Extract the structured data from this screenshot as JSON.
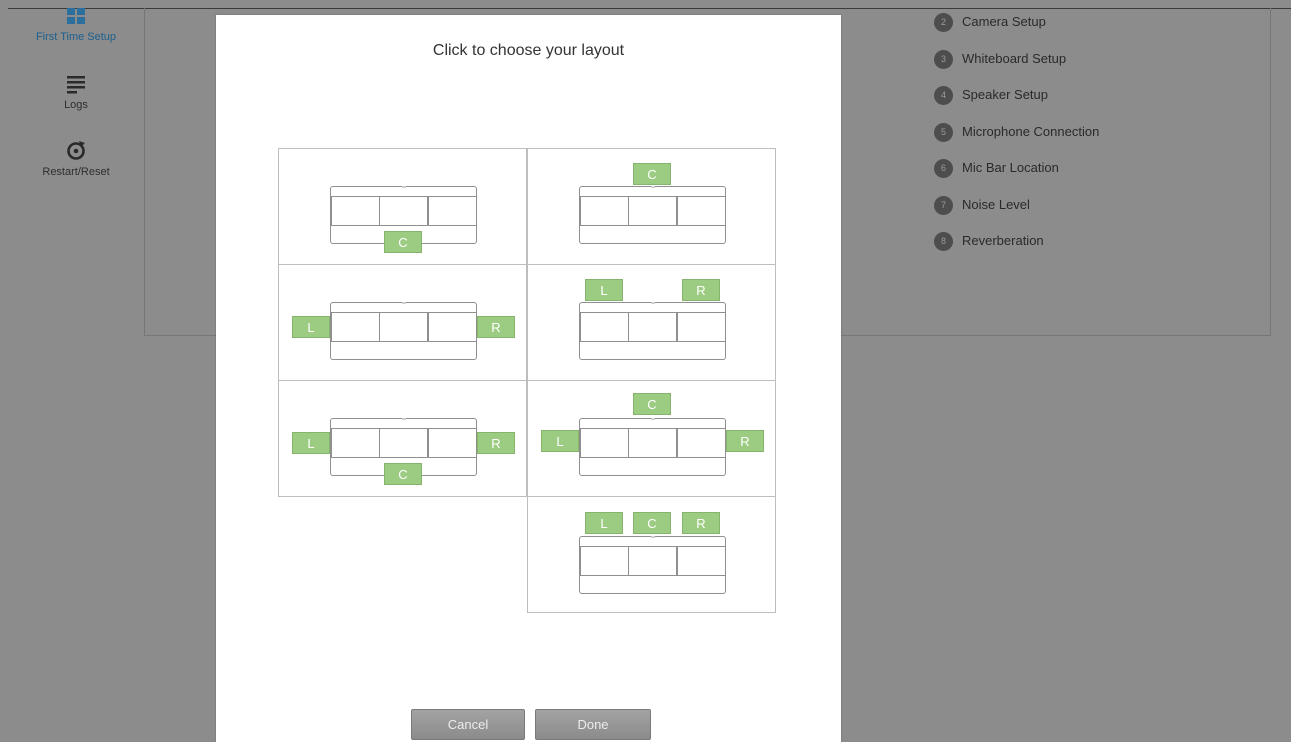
{
  "sidebar": {
    "items": [
      {
        "label": "First Time Setup",
        "icon": "grid-icon",
        "active": true
      },
      {
        "label": "Logs",
        "icon": "lines-icon"
      },
      {
        "label": "Restart/Reset",
        "icon": "restart-icon"
      }
    ]
  },
  "steps": [
    {
      "num": "2",
      "label": "Camera Setup"
    },
    {
      "num": "3",
      "label": "Whiteboard Setup"
    },
    {
      "num": "4",
      "label": "Speaker Setup"
    },
    {
      "num": "5",
      "label": "Microphone Connection"
    },
    {
      "num": "6",
      "label": "Mic Bar Location"
    },
    {
      "num": "7",
      "label": "Noise Level"
    },
    {
      "num": "8",
      "label": "Reverberation"
    }
  ],
  "modal": {
    "title": "Click to choose your layout",
    "speaker_labels": {
      "left": "L",
      "center": "C",
      "right": "R"
    },
    "layouts": [
      {
        "name": "center-below"
      },
      {
        "name": "center-above"
      },
      {
        "name": "left-right-sides"
      },
      {
        "name": "left-right-above"
      },
      {
        "name": "left-right-sides-center-below"
      },
      {
        "name": "left-right-sides-center-above"
      },
      {
        "name": "left-center-right-above"
      }
    ],
    "cancel_label": "Cancel",
    "done_label": "Done"
  },
  "colors": {
    "overlay": "#8c8c8c",
    "speaker_green": "#9ccc82",
    "active_blue": "#1d5f8c",
    "button_grey": "#999999"
  }
}
